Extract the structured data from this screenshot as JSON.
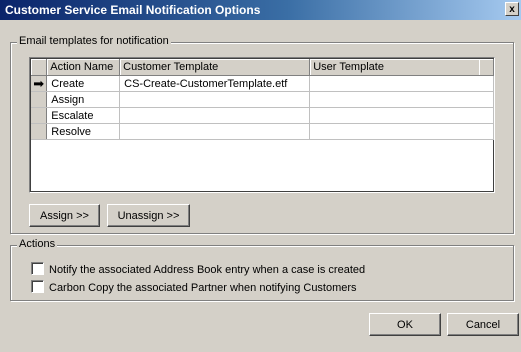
{
  "window": {
    "title": "Customer Service Email Notification Options",
    "close_glyph": "x"
  },
  "templates_group": {
    "label": "Email templates for notification",
    "columns": [
      "Action Name",
      "Customer Template",
      "User Template"
    ],
    "rows": [
      {
        "action": "Create",
        "customer_template": "CS-Create-CustomerTemplate.etf",
        "user_template": "",
        "current": true
      },
      {
        "action": "Assign",
        "customer_template": "",
        "user_template": "",
        "current": false
      },
      {
        "action": "Escalate",
        "customer_template": "",
        "user_template": "",
        "current": false
      },
      {
        "action": "Resolve",
        "customer_template": "",
        "user_template": "",
        "current": false
      }
    ],
    "current_row_icon": "arrow-right-icon",
    "current_row_glyph": "➡",
    "assign_label": "Assign >>",
    "unassign_label": "Unassign >>"
  },
  "actions_group": {
    "label": "Actions",
    "options": [
      {
        "label": "Notify the associated Address Book entry when a case is created",
        "checked": false
      },
      {
        "label": "Carbon Copy the associated Partner when notifying Customers",
        "checked": false
      }
    ]
  },
  "footer": {
    "ok_label": "OK",
    "cancel_label": "Cancel"
  }
}
